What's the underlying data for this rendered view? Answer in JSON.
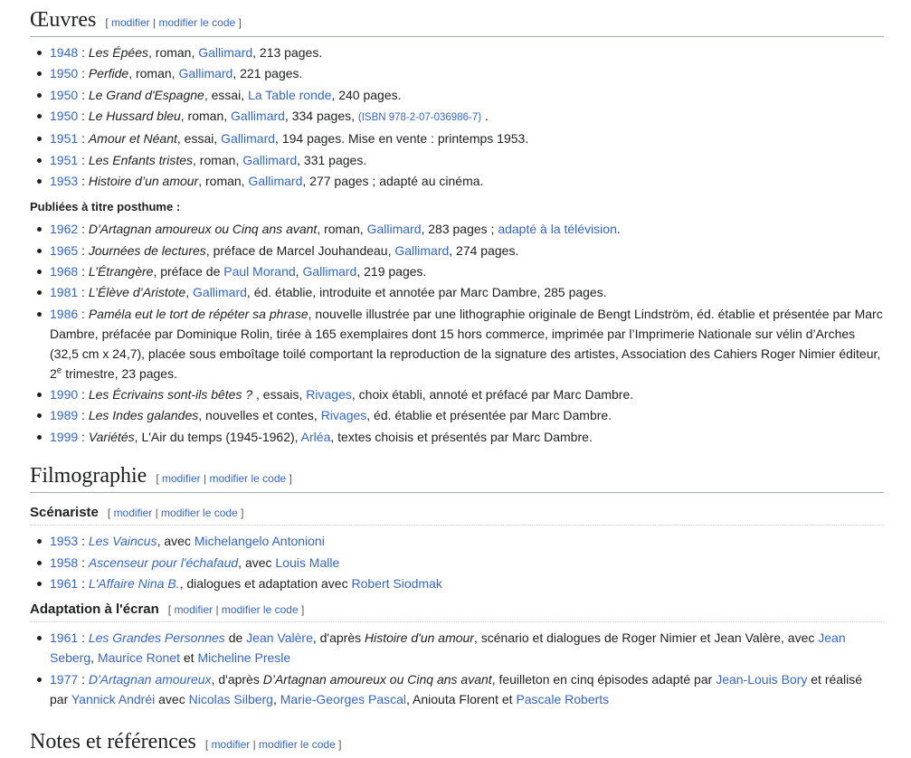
{
  "edit": {
    "modifier": "modifier",
    "modifier_code": "modifier le code",
    "sep": " | ",
    "open": "[ ",
    "close": " ]"
  },
  "oeuvres": {
    "title": "Œuvres",
    "items": [
      {
        "year": "1948",
        "title": "Les Épées",
        "rest1": ", roman, ",
        "pub": "Gallimard",
        "rest2": ", 213 pages."
      },
      {
        "year": "1950",
        "title": "Perfide",
        "rest1": ", roman, ",
        "pub": "Gallimard",
        "rest2": ", 221 pages."
      },
      {
        "year": "1950",
        "title": "Le Grand d'Espagne",
        "rest1": ", essai, ",
        "pub": "La Table ronde",
        "rest2": ", 240 pages."
      },
      {
        "year": "1950",
        "title": "Le Hussard bleu",
        "rest1": ", roman, ",
        "pub": "Gallimard",
        "rest2": ", 334 pages, ",
        "isbn": "(ISBN 978-2-07-036986-7)",
        "rest3": " ."
      },
      {
        "year": "1951",
        "title": "Amour et Néant",
        "rest1": ", essai, ",
        "pub": "Gallimard",
        "rest2": ", 194 pages. Mise en vente : printemps 1953."
      },
      {
        "year": "1951",
        "title": "Les Enfants tristes",
        "rest1": ", roman, ",
        "pub": "Gallimard",
        "rest2": ", 331 pages."
      },
      {
        "year": "1953",
        "title": "Histoire d’un amour",
        "rest1": ", roman, ",
        "pub": "Gallimard",
        "rest2": ", 277 pages ; adapté au cinéma."
      }
    ]
  },
  "posthume": {
    "heading": "Publiées à titre posthume :",
    "items": [
      {
        "year": "1962",
        "title": "D'Artagnan amoureux ou Cinq ans avant",
        "rest1": ", roman, ",
        "pub": "Gallimard",
        "rest2": ", 283 pages ; ",
        "link2": "adapté à la télévision",
        "rest3": "."
      },
      {
        "year": "1965",
        "title": "Journées de lectures",
        "rest1": ", préface de Marcel Jouhandeau, ",
        "pub": "Gallimard",
        "rest2": ", 274 pages."
      },
      {
        "year": "1968",
        "title": "L’Étrangère",
        "rest1": ", préface de ",
        "link0": "Paul Morand",
        "sep0": ", ",
        "pub": "Gallimard",
        "rest2": ", 219 pages."
      },
      {
        "year": "1981",
        "title": "L’Élève d’Aristote",
        "rest1": ", ",
        "pub": "Gallimard",
        "rest2": ", éd. établie, introduite et annotée par Marc Dambre, 285 pages."
      },
      {
        "year": "1986",
        "title": "Paméla eut le tort de répéter sa phrase",
        "rest1": ", nouvelle illustrée par une lithographie originale de Bengt Lindström, éd. établie et présentée par Marc Dambre, préfacée par Dominique Rolin, tirée à 165 exemplaires dont 15 hors commerce, imprimée par l’Imprimerie Nationale sur vélin d’Arches (32,5 cm x 24,7), placée sous emboîtage toilé comportant la reproduction de la signature des artistes, Association des Cahiers Roger Nimier éditeur, 2",
        "sup": "e",
        "rest2": " trimestre, 23 pages."
      },
      {
        "year": "1990",
        "title": "Les Écrivains sont-ils bêtes ?",
        "rest1": " , essais, ",
        "pub": "Rivages",
        "rest2": ", choix établi, annoté et préfacé par Marc Dambre."
      },
      {
        "year": "1989",
        "title": "Les Indes galandes",
        "rest1": ", nouvelles et contes, ",
        "pub": "Rivages",
        "rest2": ", éd. établie et présentée par Marc Dambre."
      },
      {
        "year": "1999",
        "title": "Variétés",
        "rest1": ", L'Air du temps (1945-1962), ",
        "pub": "Arléa",
        "rest2": ", textes choisis et présentés par Marc Dambre."
      }
    ]
  },
  "filmo": {
    "title": "Filmographie",
    "scenariste": {
      "title": "Scénariste",
      "items": [
        {
          "year": "1953",
          "film": "Les Vaincus",
          "rest1": ", avec ",
          "link1": "Michelangelo Antonioni"
        },
        {
          "year": "1958",
          "film": "Ascenseur pour l'échafaud",
          "rest1": ", avec ",
          "link1": "Louis Malle"
        },
        {
          "year": "1961",
          "film": "L'Affaire Nina B.",
          "rest1": ", dialogues et adaptation avec ",
          "link1": "Robert Siodmak"
        }
      ]
    },
    "adaptation": {
      "title": "Adaptation à l'écran",
      "items": [
        {
          "year": "1961",
          "film": "Les Grandes Personnes",
          "a": " de ",
          "b": "Jean Valère",
          "c": ", d'après ",
          "d": "Histoire d'un amour",
          "e": ", scénario et dialogues de Roger Nimier et Jean Valère, avec ",
          "f": "Jean Seberg",
          "g": ", ",
          "h": "Maurice Ronet",
          "i": " et ",
          "j": "Micheline Presle"
        },
        {
          "year": "1977",
          "film": "D'Artagnan amoureux",
          "a": ", d'après ",
          "b": "D’Artagnan amoureux ou Cinq ans avant",
          "c": ", feuilleton en cinq épisodes adapté par ",
          "d": "Jean-Louis Bory",
          "e": " et réalisé par ",
          "f": "Yannick Andréi",
          "g": " avec ",
          "h": "Nicolas Silberg",
          "i": ", ",
          "j": "Marie-Georges Pascal",
          "k": ", Aniouta Florent et ",
          "l": "Pascale Roberts"
        }
      ]
    }
  },
  "notes": {
    "title": "Notes et références"
  },
  "colors": {
    "link": "#3366cc",
    "text": "#202122",
    "rule": "#a2a9b1"
  }
}
